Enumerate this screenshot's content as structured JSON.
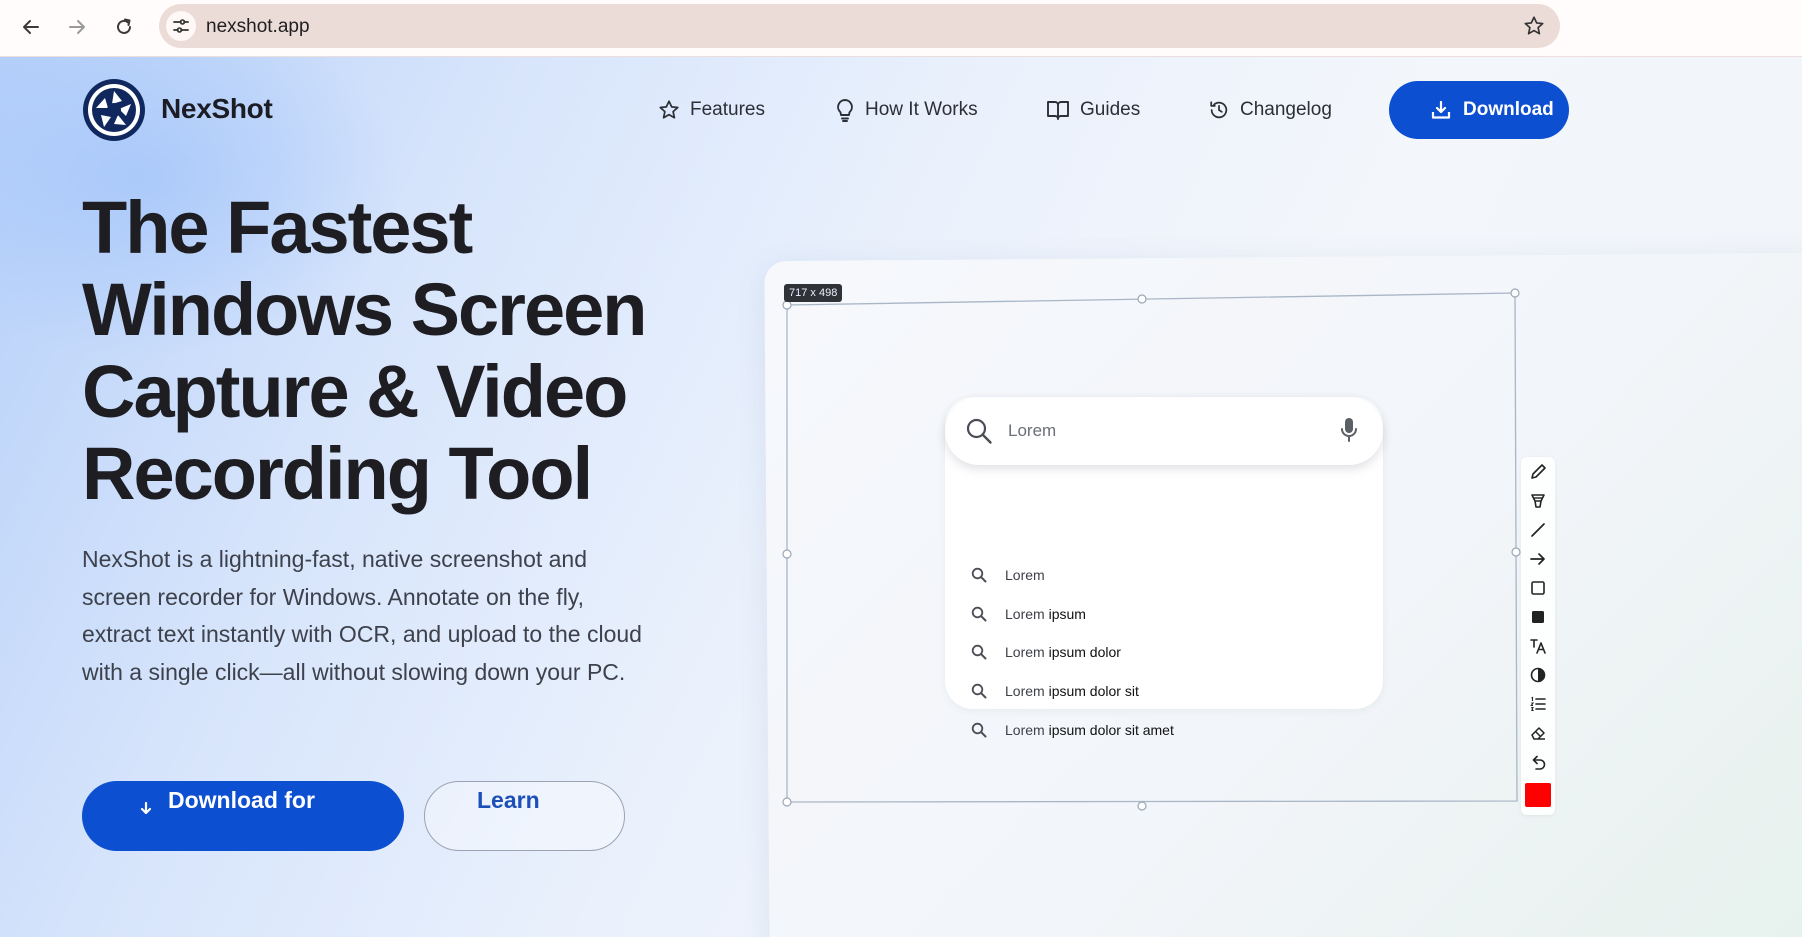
{
  "browser": {
    "url": "nexshot.app",
    "back_icon": "arrow-left",
    "forward_icon": "arrow-right",
    "reload_icon": "reload",
    "site_info_icon": "tune",
    "bookmark_icon": "star-outline"
  },
  "header": {
    "brand": "NexShot",
    "logo_icon": "shutter-aperture",
    "nav": [
      {
        "label": "Features",
        "icon": "star-outline"
      },
      {
        "label": "How It Works",
        "icon": "lightbulb"
      },
      {
        "label": "Guides",
        "icon": "open-book"
      },
      {
        "label": "Changelog",
        "icon": "history"
      }
    ],
    "download_label": "Download",
    "download_icon": "download"
  },
  "hero": {
    "headline": "The Fastest Windows Screen Capture & Video Recording Tool",
    "description": "NexShot is a lightning-fast, native screenshot and screen recorder for Windows. Annotate on the fly, extract text instantly with OCR, and upload to the cloud with a single click—all without slowing down your PC.",
    "primary_cta": "Download for",
    "secondary_cta": "Learn"
  },
  "preview": {
    "dimensions_label": "717 x 498",
    "search_query": "Lorem",
    "suggestions": [
      {
        "prefix": "Lorem",
        "rest": ""
      },
      {
        "prefix": "Lorem",
        "rest": " ipsum"
      },
      {
        "prefix": "Lorem",
        "rest": " ipsum dolor"
      },
      {
        "prefix": "Lorem",
        "rest": " ipsum dolor sit"
      },
      {
        "prefix": "Lorem",
        "rest": " ipsum dolor sit amet"
      }
    ],
    "toolbar_tools": [
      "pencil",
      "highlighter",
      "line",
      "arrow",
      "rectangle",
      "filled-rectangle",
      "text",
      "blur",
      "numbered-list",
      "eraser",
      "undo"
    ],
    "active_color": "#ff0000"
  },
  "colors": {
    "accent": "#0c4fd1",
    "headline": "#1d1d22",
    "omnibox": "#ecdcd8"
  }
}
